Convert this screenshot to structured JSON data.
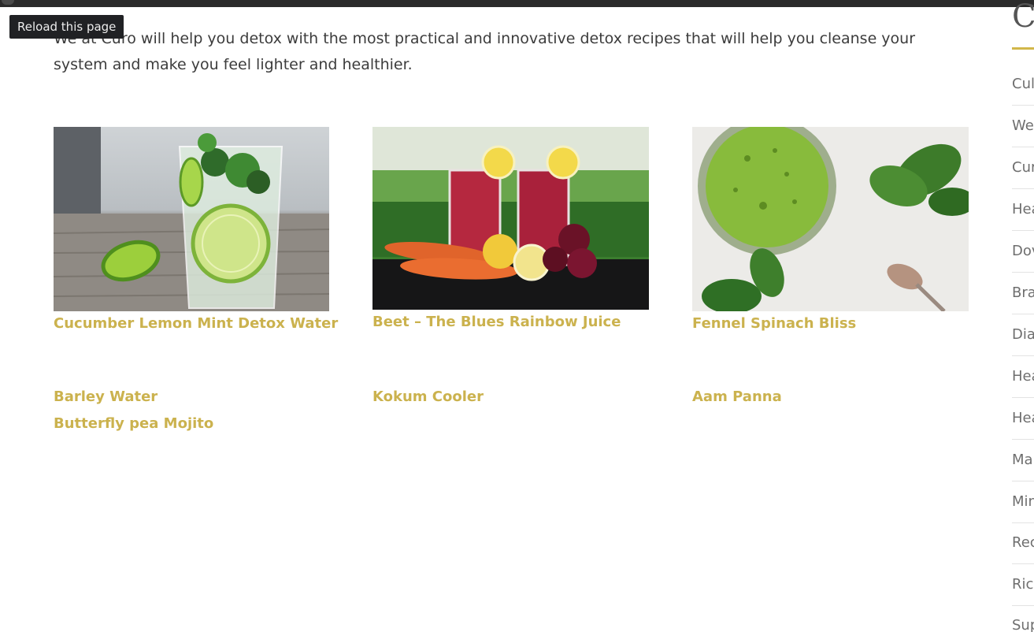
{
  "browser": {
    "tooltip": "Reload this page"
  },
  "intro": {
    "text": "We at Curo will help you detox with the most practical and innovative detox recipes that will help you cleanse your system and make you feel lighter and healthier."
  },
  "cards": [
    {
      "title": "Cucumber Lemon Mint Detox Water"
    },
    {
      "title": "Beet – The Blues Rainbow Juice"
    },
    {
      "title": "Fennel Spinach Bliss"
    }
  ],
  "links": [
    {
      "label": "Barley Water"
    },
    {
      "label": "Kokum Cooler"
    },
    {
      "label": "Aam Panna"
    },
    {
      "label": "Butterfly pea Mojito"
    }
  ],
  "sidebar": {
    "heading": "Ca",
    "items": [
      "Cul",
      "We",
      "Cur",
      "Hea",
      "Dov",
      "Bra",
      "Dia",
      "Hea",
      "Hea",
      "Ma",
      "Min",
      "Rec",
      "Ric",
      "Sup"
    ]
  },
  "colors": {
    "accent": "#cbb24e",
    "text": "#3c3c3c",
    "muted": "#6e6e6e"
  }
}
